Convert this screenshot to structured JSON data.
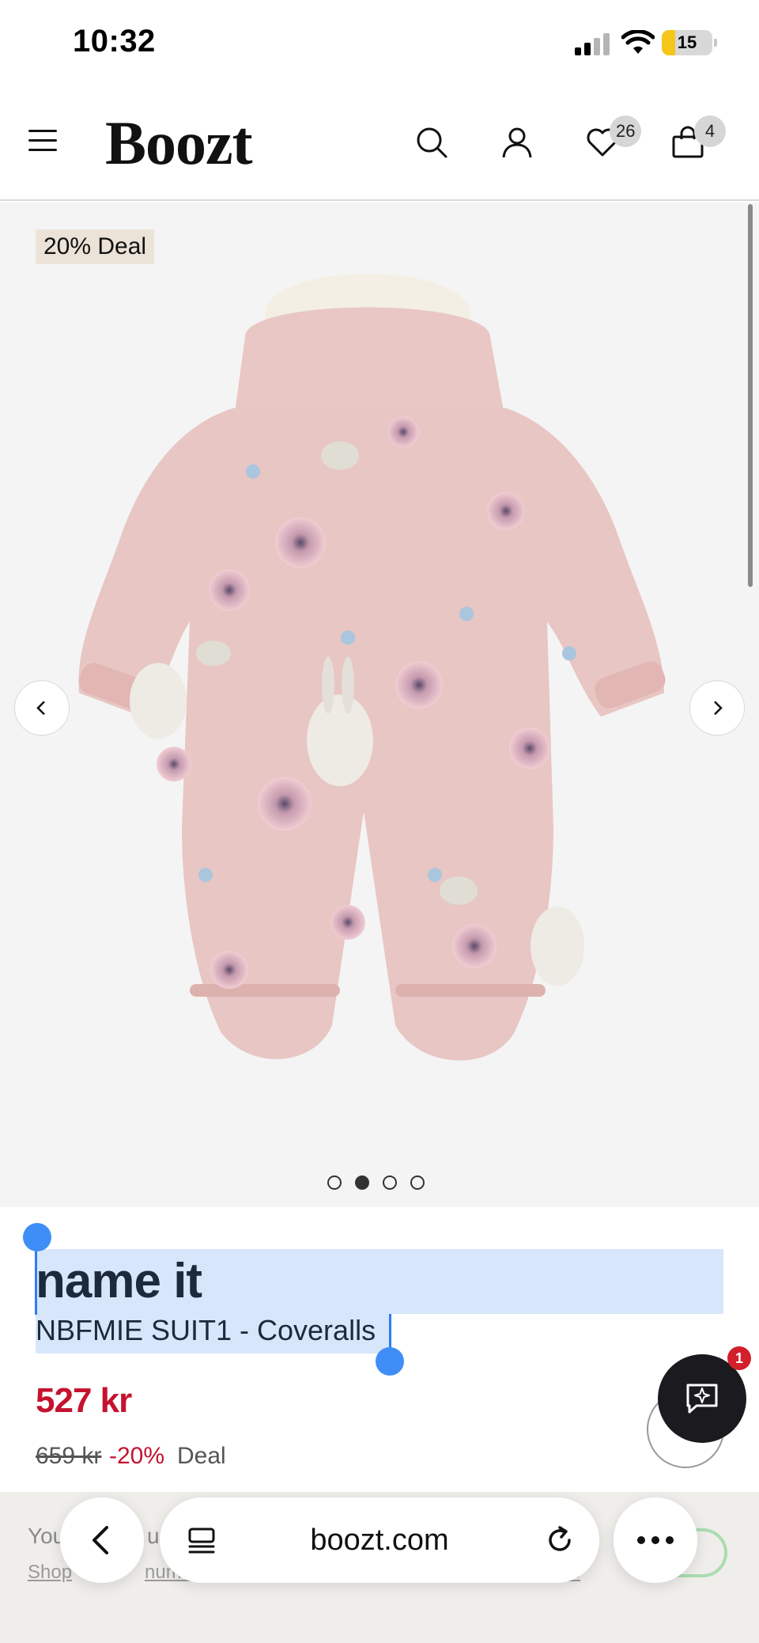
{
  "status_bar": {
    "time": "10:32",
    "battery": "15"
  },
  "header": {
    "logo": "Boozt",
    "wishlist_count": "26",
    "bag_count": "4"
  },
  "gallery": {
    "deal_tag": "20% Deal",
    "image_count": 4,
    "active_image": 2
  },
  "product": {
    "brand": "name it",
    "name": "NBFMIE SUIT1 - Coveralls",
    "price": "527 kr",
    "old_price": "659 kr",
    "discount": "-20%",
    "deal_label": "Deal"
  },
  "chat": {
    "badge": "1"
  },
  "under_bar": {
    "text": "You",
    "text_mid": "ur",
    "link": "Shop",
    "link_mid": "num 2",
    "link_right": "ks"
  },
  "browser": {
    "url": "boozt.com"
  },
  "colors": {
    "price_red": "#c4132e",
    "selection_blue": "#d7e6fb",
    "handle_blue": "#3f8ef7"
  }
}
